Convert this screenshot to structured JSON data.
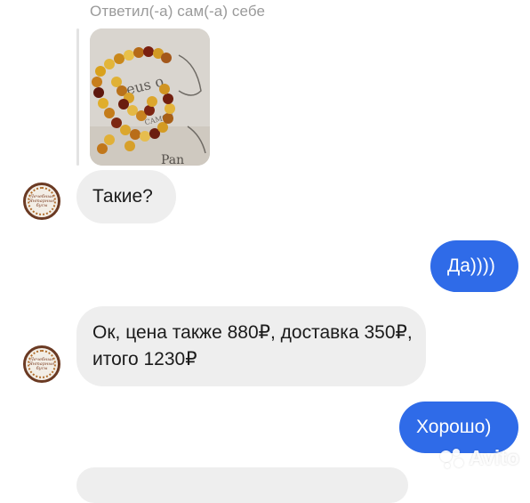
{
  "chat": {
    "reply_note": "Ответил(-а) сам(-а) себе",
    "messages": [
      {
        "side": "in",
        "text": "Такие?"
      },
      {
        "side": "out",
        "text": "Да))))"
      },
      {
        "side": "in",
        "text": "Ок, цена также 880₽, доставка 350₽, итого 1230₽"
      },
      {
        "side": "out",
        "text": "Хорошо)"
      }
    ]
  },
  "avatar": {
    "logo_text": "Лечебные Янтарные бусы"
  },
  "watermark": {
    "text": "Avito"
  },
  "colors": {
    "outgoing_bubble": "#2f6be8",
    "incoming_bubble": "#eeeeee"
  }
}
